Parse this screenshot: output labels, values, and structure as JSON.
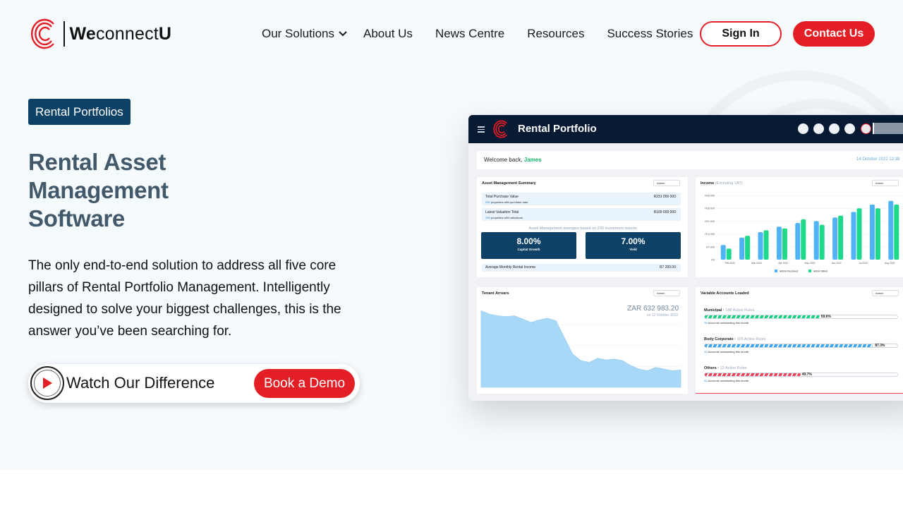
{
  "brand": {
    "logo_bold": "We",
    "logo_mid": "connect",
    "logo_end": "U",
    "red": "#e31e24",
    "navy": "#0d4166"
  },
  "nav": {
    "items": [
      "Our Solutions",
      "About Us",
      "News Centre",
      "Resources",
      "Success Stories"
    ],
    "sign_in": "Sign In",
    "contact": "Contact Us"
  },
  "hero": {
    "badge": "Rental Portfolios",
    "headline": "Rental Asset Management Software",
    "description": "The only end-to-end solution to address all five core pillars of Rental Portfolio Management. Intelligently designed to solve your biggest challenges, this is the answer you’ve been searching for.",
    "watch_label": "Watch Our Difference",
    "demo_label": "Book a Demo"
  },
  "dashboard": {
    "title": "Rental Portfolio",
    "welcome_prefix": "Welcome back, ",
    "user": "James",
    "date": "14 October 2022 12:38",
    "summary": {
      "title": "Asset Management Summary",
      "filter": "Admin",
      "purchase_label": "Total Purchase Value",
      "purchase_value": "R231 000 000",
      "purchase_count": "230",
      "purchase_sub": " properties with purchase data",
      "valuation_label": "Latest Valuation Total",
      "valuation_value": "R199 000 000",
      "valuation_count": "199",
      "valuation_sub": " properties with valuations",
      "averages_caption": "Asset Management averages based on 230 investment reports",
      "growth_value": "8.00%",
      "growth_label": "Capital Growth",
      "yield_value": "7.00%",
      "yield_label": "Yield",
      "rental_label": "Average Monthly Rental Income",
      "rental_value": "R7 200.00"
    },
    "income": {
      "title": "Income",
      "title_note": "(Excluding VAT)",
      "filter": "Admin"
    },
    "arrears": {
      "title": "Tenant Arrears",
      "filter": "Admin",
      "amount": "ZAR 632 983.20",
      "as_of": "on 12 October 2022"
    },
    "variable": {
      "title": "Variable Accounts Loaded",
      "filter": "Admin",
      "items": [
        {
          "name": "Municipal",
          "rules": "188 Active Rules",
          "count": "76",
          "sub": " Accounts outstanding this month",
          "pct": 59.6,
          "pct_label": "59.6%",
          "color": "#12d183"
        },
        {
          "name": "Body Corporate",
          "rules": "105 Active Rules",
          "count": "13",
          "sub": " Accounts outstanding this month",
          "pct": 87.3,
          "pct_label": "87.3%",
          "color": "#3aa5ec"
        },
        {
          "name": "Others",
          "rules": "12 Active Rules",
          "count": "32",
          "sub": " Accounts outstanding this month",
          "pct": 49.7,
          "pct_label": "49.7%",
          "color": "#f0435a"
        }
      ]
    }
  },
  "chart_data": [
    {
      "type": "bar",
      "title": "Income",
      "y_ticks": [
        "R0",
        "R7 000",
        "R14 000",
        "R21 000",
        "R28 000",
        "R35 000"
      ],
      "x_tick_labels": [
        "Feb 2022",
        "Mar 2022",
        "Apr 2022",
        "May 2022",
        "Jun 2022",
        "Jul 2022",
        "Aug 2022"
      ],
      "ylim": [
        0,
        35000
      ],
      "series": [
        {
          "name": "Admin Received",
          "color": "#4fb3f5",
          "values": [
            8000,
            12000,
            15000,
            18000,
            20000,
            21000,
            23000,
            26000,
            30000,
            32000
          ]
        },
        {
          "name": "Admin Billed",
          "color": "#1ed98a",
          "values": [
            6000,
            13000,
            16000,
            17000,
            22000,
            19000,
            24000,
            28000,
            28000,
            30000
          ]
        }
      ]
    },
    {
      "type": "area",
      "title": "Tenant Arrears",
      "color": "#a8d8f7",
      "ylim": [
        0,
        100
      ],
      "values": [
        92,
        88,
        86,
        85,
        86,
        82,
        78,
        81,
        83,
        80,
        60,
        40,
        32,
        30,
        35,
        33,
        34,
        32,
        26,
        22,
        20,
        24,
        22,
        20,
        21
      ]
    }
  ]
}
